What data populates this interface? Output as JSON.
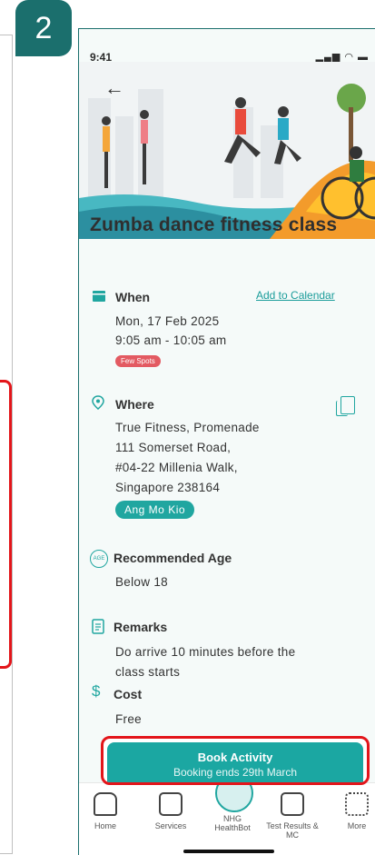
{
  "step_number": "2",
  "status": {
    "time": "9:41",
    "signal_icons": "▂▄▆ ◠ ▬"
  },
  "activity": {
    "title": "Zumba dance fitness class",
    "when": {
      "label": "When",
      "add_to_calendar": "Add to Calendar",
      "date": "Mon, 17 Feb 2025",
      "time": "9:05 am - 10:05 am",
      "badge": "Few Spots"
    },
    "where": {
      "label": "Where",
      "line1": "True Fitness, Promenade",
      "line2": "111 Somerset Road,",
      "line3": "#04-22 Millenia Walk,",
      "line4": "Singapore 238164",
      "area_badge": "Ang Mo Kio"
    },
    "age": {
      "label": "Recommended Age",
      "value": "Below 18",
      "icon_text": "AGE"
    },
    "remarks": {
      "label": "Remarks",
      "line1": "Do arrive 10 minutes before the",
      "line2": "class starts"
    },
    "cost": {
      "label": "Cost",
      "value": "Free",
      "icon_text": "$"
    }
  },
  "book": {
    "label": "Book Activity",
    "sub": "Booking ends 29th March"
  },
  "nav": [
    {
      "label": "Home"
    },
    {
      "label": "Services"
    },
    {
      "label": "NHG HealthBot"
    },
    {
      "label": "Test Results & MC"
    },
    {
      "label": "More"
    }
  ],
  "colors": {
    "accent": "#1ba7a2",
    "highlight": "#e3151a",
    "badge_bg": "#1b6f6d"
  }
}
